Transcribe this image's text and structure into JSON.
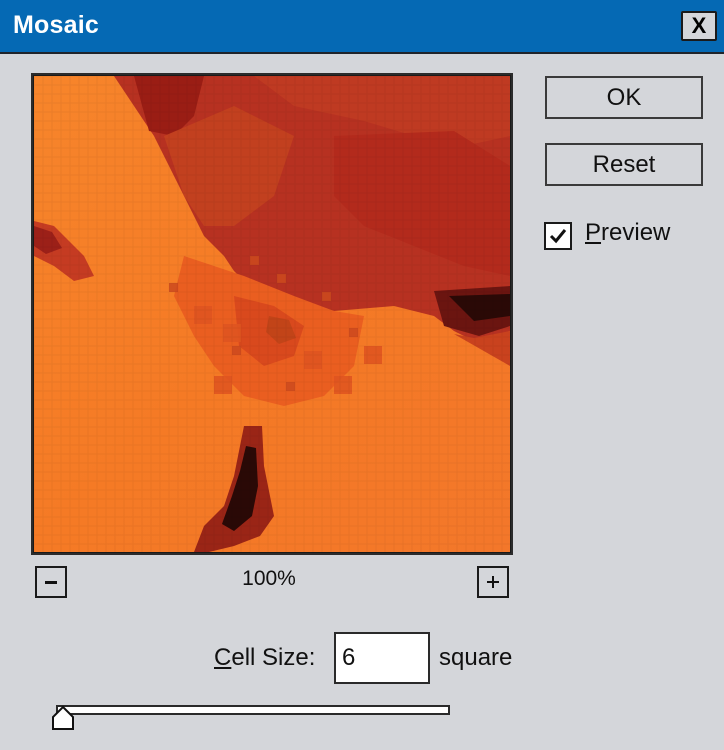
{
  "window": {
    "title": "Mosaic",
    "close_label": "X"
  },
  "buttons": {
    "ok_label": "OK",
    "reset_label": "Reset"
  },
  "preview_option": {
    "label": "Preview",
    "checked": true
  },
  "zoom": {
    "level": "100%",
    "zoom_out_icon": "minus-icon",
    "zoom_in_icon": "plus-icon"
  },
  "cell_size": {
    "label": "Cell Size:",
    "value": "6",
    "unit": "square"
  },
  "slider": {
    "value": 6
  },
  "colors": {
    "titlebar": "#0569b4",
    "dialog_bg": "#d4d6da",
    "mosaic_orange": "#f57a25",
    "mosaic_red": "#b32d20",
    "mosaic_dark": "#2a0906"
  }
}
